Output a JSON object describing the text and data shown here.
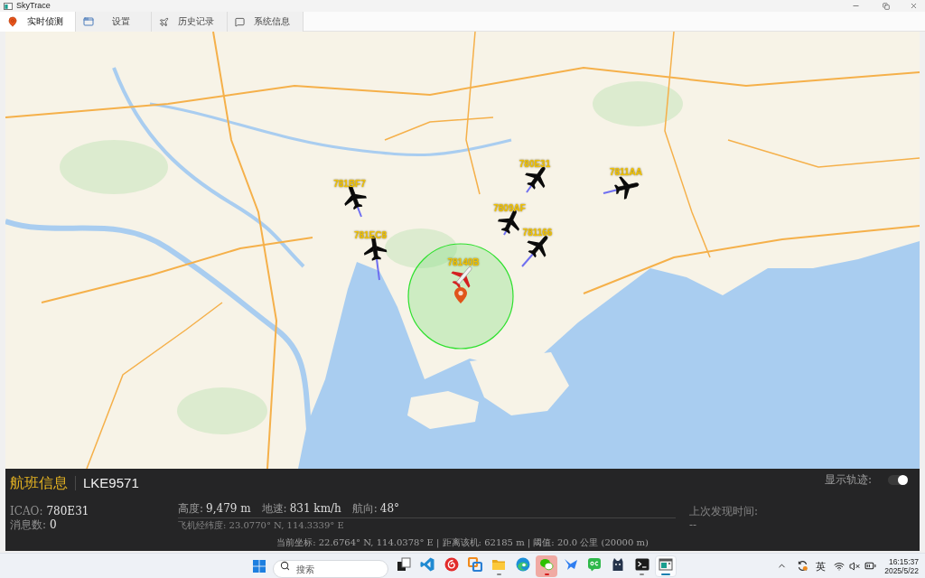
{
  "window": {
    "title": "SkyTrace"
  },
  "tabs": [
    {
      "label": "实时侦测",
      "kind": "live",
      "selected": true
    },
    {
      "label": "设置",
      "kind": "settings",
      "selected": false
    },
    {
      "label": "历史记录",
      "kind": "history",
      "selected": false
    },
    {
      "label": "系统信息",
      "kind": "system",
      "selected": false
    }
  ],
  "map": {
    "aircraft": [
      {
        "label": "780E31",
        "selected": false
      },
      {
        "label": "7811AA",
        "selected": false
      },
      {
        "label": "781BF7",
        "selected": false
      },
      {
        "label": "7809AF",
        "selected": false
      },
      {
        "label": "781166",
        "selected": false
      },
      {
        "label": "781EC8",
        "selected": false
      },
      {
        "label": "78140B",
        "selected": true
      }
    ]
  },
  "flight_panel": {
    "title": "航班信息",
    "callsign": "LKE9571",
    "show_track": {
      "label": "显示轨迹:",
      "on": true
    },
    "identity": [
      {
        "label": "ICAO:",
        "value": "780E31"
      },
      {
        "label": "消息数:",
        "value": "0"
      }
    ],
    "motion": [
      {
        "label": "高度:",
        "value": "9,479 m"
      },
      {
        "label": "地速:",
        "value": "831 km/h"
      },
      {
        "label": "航向:",
        "value": "48°"
      }
    ],
    "aircraft_position": "飞机经纬度: 23.0770° N, 114.3339° E",
    "last_seen": {
      "label": "上次发现时间:",
      "value": "--"
    },
    "status_line": "当前坐标: 22.6764° N, 114.0378° E | 距离该机: 62185 m | 阈值: 20.0 公里 (20000 m)"
  },
  "taskbar": {
    "search": {
      "placeholder": "搜索"
    },
    "apps": [
      {
        "kind": "taskview",
        "running": false,
        "selected": false,
        "flashing": false
      },
      {
        "kind": "editor",
        "running": false,
        "selected": false,
        "flashing": false
      },
      {
        "kind": "music",
        "running": false,
        "selected": false,
        "flashing": false
      },
      {
        "kind": "remote",
        "running": false,
        "selected": false,
        "flashing": false
      },
      {
        "kind": "files",
        "running": true,
        "selected": false,
        "flashing": false
      },
      {
        "kind": "browser",
        "running": false,
        "selected": false,
        "flashing": false
      },
      {
        "kind": "chat",
        "running": true,
        "selected": false,
        "flashing": true
      },
      {
        "kind": "bird",
        "running": false,
        "selected": false,
        "flashing": false
      },
      {
        "kind": "tile",
        "running": false,
        "selected": false,
        "flashing": false
      },
      {
        "kind": "cat",
        "running": false,
        "selected": false,
        "flashing": false
      },
      {
        "kind": "terminal",
        "running": true,
        "selected": false,
        "flashing": false
      },
      {
        "kind": "skytrace",
        "running": true,
        "selected": true,
        "flashing": false
      }
    ],
    "tray": {
      "input_method": "英",
      "time": "16:15:37",
      "date": "2025/5/22"
    }
  }
}
